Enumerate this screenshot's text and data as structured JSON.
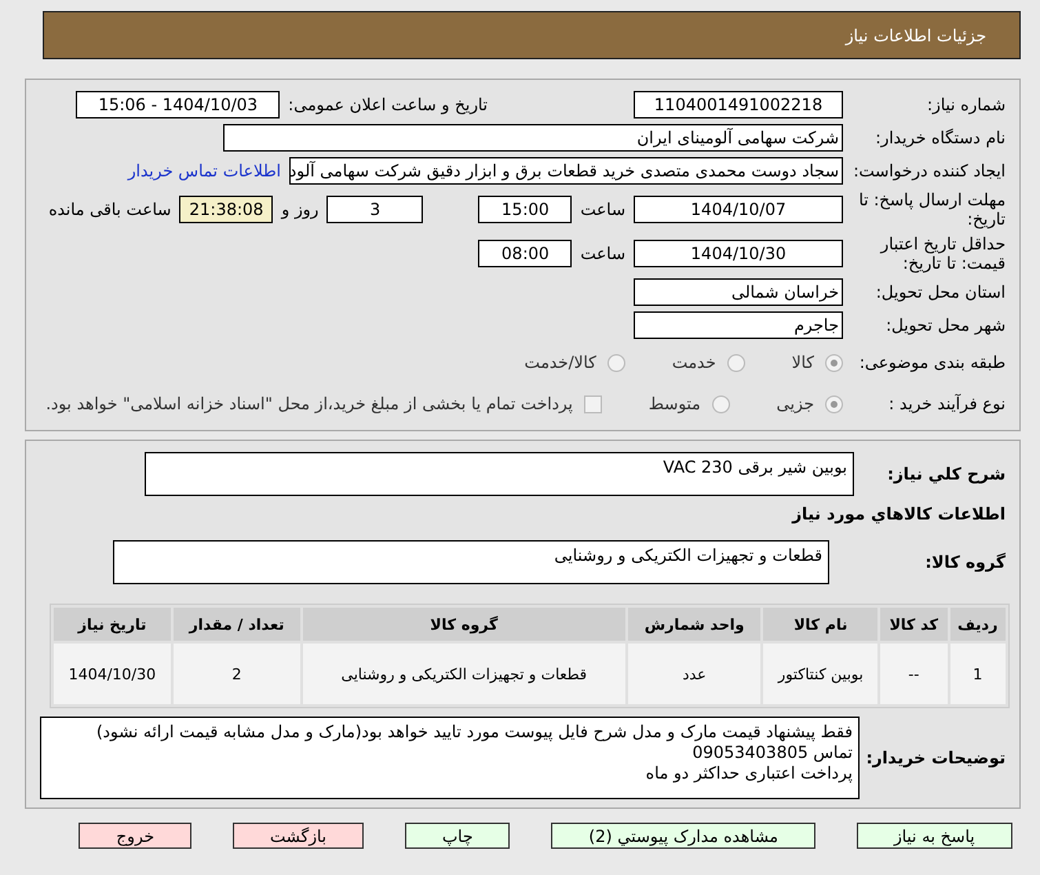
{
  "header": {
    "title": "جزئیات اطلاعات نیاز"
  },
  "details": {
    "need_number": {
      "label": "شماره نیاز:",
      "value": "1104001491002218"
    },
    "announce": {
      "label": "تاریخ و ساعت اعلان عمومی:",
      "value": "1404/10/03 - 15:06"
    },
    "buyer": {
      "label": "نام دستگاه خریدار:",
      "value": "شرکت سهامی آلومینای ایران"
    },
    "creator": {
      "label": "ایجاد کننده درخواست:",
      "value": "سجاد دوست محمدی متصدی خرید قطعات برق و ابزار دقیق شرکت سهامی آلود",
      "link": "اطلاعات تماس خریدار"
    },
    "deadline": {
      "label": "مهلت ارسال پاسخ: تا تاریخ:",
      "date": "1404/10/07",
      "time_label": "ساعت",
      "time": "15:00",
      "days": "3",
      "days_label": "روز و",
      "remaining": "21:38:08",
      "remaining_label": "ساعت باقی مانده"
    },
    "validity": {
      "label": "حداقل تاریخ اعتبار قیمت: تا تاریخ:",
      "date": "1404/10/30",
      "time_label": "ساعت",
      "time": "08:00"
    },
    "province": {
      "label": "استان محل تحویل:",
      "value": "خراسان شمالی"
    },
    "city": {
      "label": "شهر محل تحویل:",
      "value": "جاجرم"
    },
    "category": {
      "label": "طبقه بندی موضوعی:",
      "options": [
        {
          "label": "کالا",
          "selected": true
        },
        {
          "label": "خدمت",
          "selected": false
        },
        {
          "label": "کالا/خدمت",
          "selected": false
        }
      ]
    },
    "process": {
      "label": "نوع فرآیند خرید :",
      "options": [
        {
          "label": "جزیی",
          "selected": true
        },
        {
          "label": "متوسط",
          "selected": false
        }
      ],
      "checkbox": {
        "label": "پرداخت تمام یا بخشی از مبلغ خرید،از محل \"اسناد خزانه اسلامی\" خواهد بود.",
        "checked": false
      }
    }
  },
  "summary": {
    "label": "شرح كلي نياز:",
    "value": "بوبین شیر برقی VAC 230"
  },
  "goods_heading": "اطلاعات كالاهاي مورد نياز",
  "goods_group": {
    "label": "گروه کالا:",
    "value": "قطعات و تجهیزات الکتریکی و روشنایی"
  },
  "table": {
    "columns": [
      "ردیف",
      "کد کالا",
      "نام کالا",
      "واحد شمارش",
      "گروه کالا",
      "تعداد / مقدار",
      "تاریخ نیاز"
    ],
    "rows": [
      [
        "1",
        "--",
        "بوبین کنتاکتور",
        "عدد",
        "قطعات و تجهیزات الکتریکی و روشنایی",
        "2",
        "1404/10/30"
      ]
    ]
  },
  "notes": {
    "label": "توضیحات خریدار:",
    "lines": [
      "فقط پیشنهاد قیمت مارک و مدل شرح فایل پیوست مورد تایید خواهد بود(مارک و مدل مشابه قیمت ارائه نشود)",
      "تماس 09053403805",
      "پرداخت اعتباری حداکثر دو ماه"
    ]
  },
  "buttons": [
    {
      "label": "پاسخ به نیاز",
      "kind": "green"
    },
    {
      "label": "مشاهده مدارک پیوستي (2)",
      "kind": "green"
    },
    {
      "label": "چاپ",
      "kind": "green"
    },
    {
      "label": "بازگشت",
      "kind": "red"
    },
    {
      "label": "خروج",
      "kind": "red"
    }
  ]
}
